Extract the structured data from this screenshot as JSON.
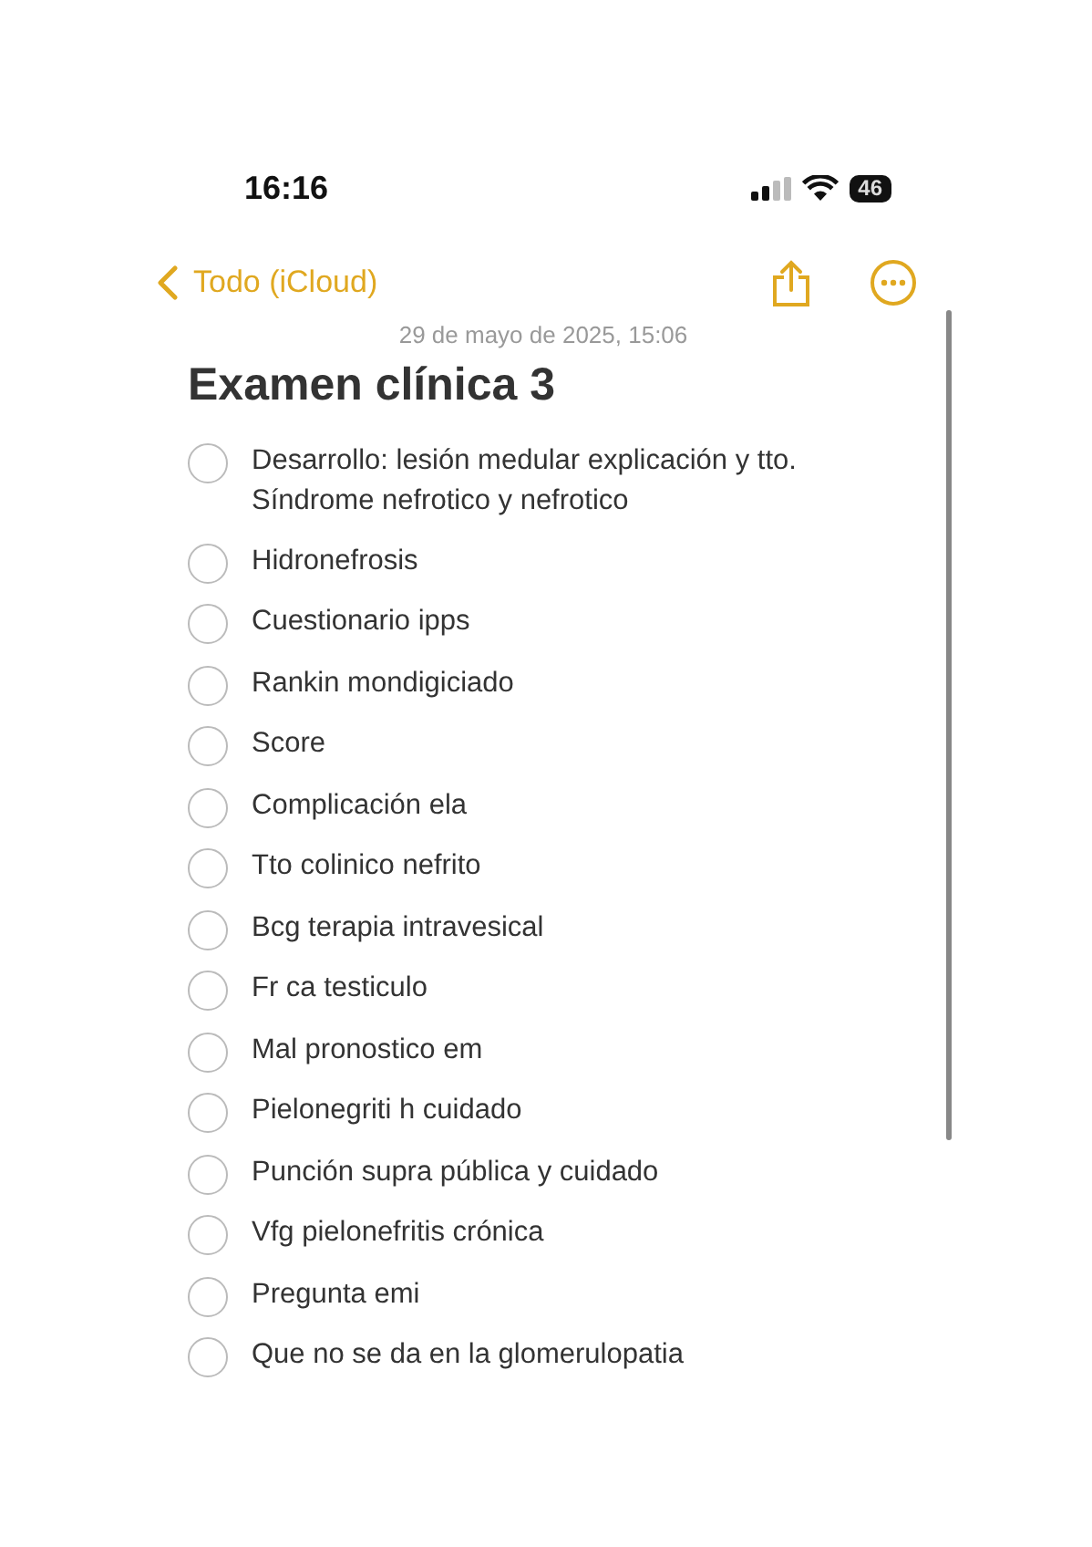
{
  "status_bar": {
    "time": "16:16",
    "battery": "46"
  },
  "nav": {
    "back": "Todo (iCloud)"
  },
  "note": {
    "date": "29 de mayo de 2025, 15:06",
    "title": "Examen clínica 3",
    "checklist": [
      {
        "text": "Desarrollo: lesión medular explicación y tto.\nSíndrome nefrotico y nefrotico",
        "checked": false
      },
      {
        "text": "Hidronefrosis",
        "checked": false
      },
      {
        "text": "Cuestionario ipps",
        "checked": false
      },
      {
        "text": "Rankin mondigiciado",
        "checked": false
      },
      {
        "text": "Score",
        "checked": false
      },
      {
        "text": "Complicación ela",
        "checked": false
      },
      {
        "text": "Tto colinico nefrito",
        "checked": false
      },
      {
        "text": "Bcg terapia intravesical",
        "checked": false
      },
      {
        "text": "Fr ca testiculo",
        "checked": false
      },
      {
        "text": "Mal pronostico em",
        "checked": false
      },
      {
        "text": "Pielonegriti h cuidado",
        "checked": false
      },
      {
        "text": "Punción supra pública y cuidado",
        "checked": false
      },
      {
        "text": "Vfg pielonefritis crónica",
        "checked": false
      },
      {
        "text": "Pregunta emi",
        "checked": false
      },
      {
        "text": "Que no se da en la glomerulopatia",
        "checked": false
      }
    ]
  }
}
